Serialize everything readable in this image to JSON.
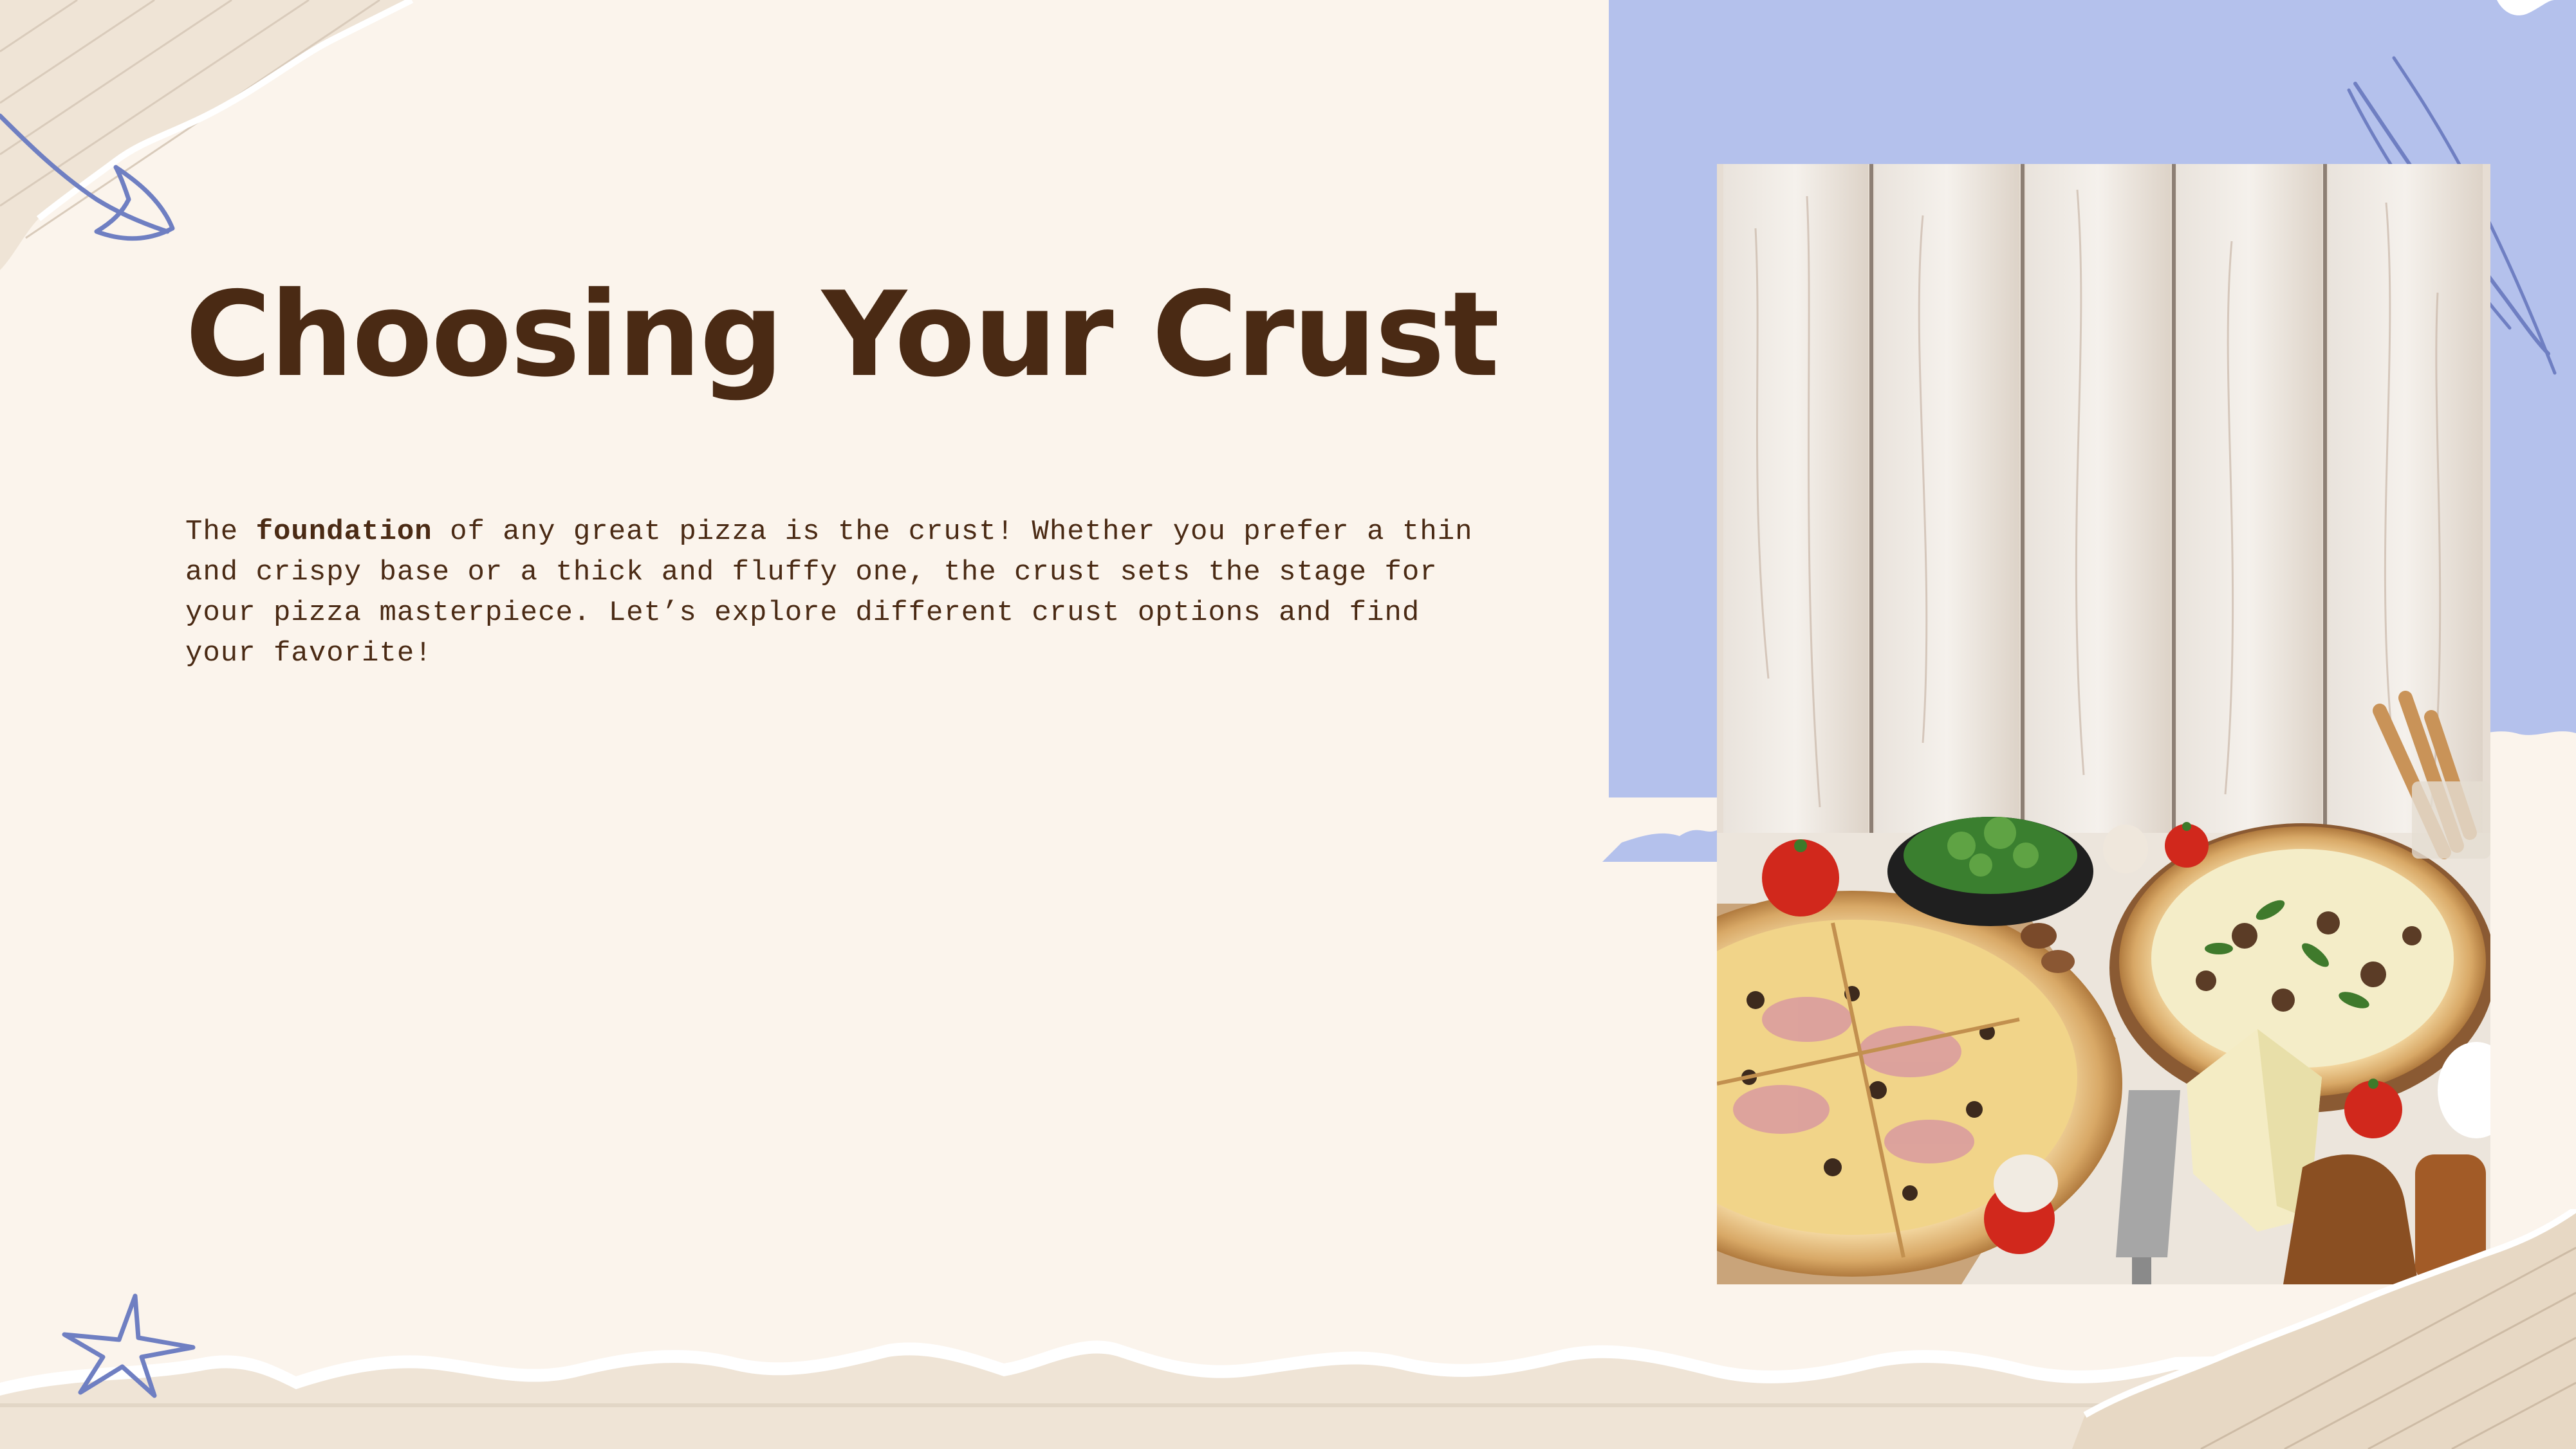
{
  "slide": {
    "title": "Choosing Your Crust",
    "body": {
      "before": "The ",
      "emphasis": "foundation",
      "after": " of any great pizza is the crust! Whether you prefer a thin and crispy base or a thick and fluffy one, the crust sets the stage for your pizza masterpiece. Let’s explore different crust options and find your favorite!"
    },
    "image": {
      "subject": "pizzas-on-wooden-table-photo"
    }
  },
  "colors": {
    "background": "#fbf4ec",
    "title": "#4a2a14",
    "accent_blue": "#b4c1ec",
    "doodle_blue": "#6f7fc2",
    "paper_torn": "#efe4d6"
  }
}
